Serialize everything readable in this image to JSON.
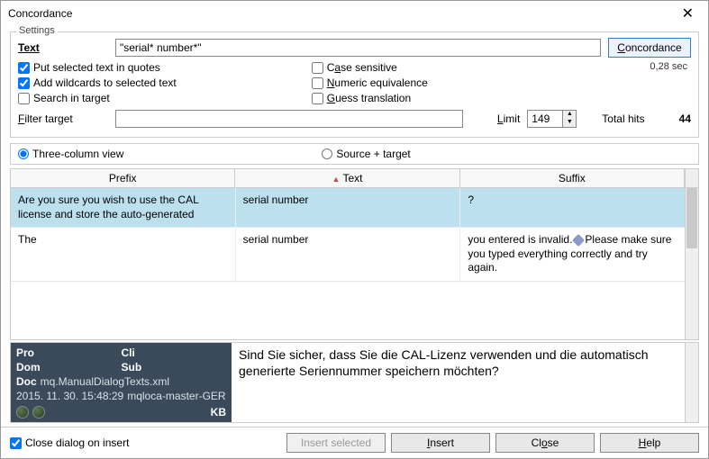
{
  "window": {
    "title": "Concordance"
  },
  "settings": {
    "legend": "Settings",
    "text_label": "Text",
    "text_value": "\"serial* number*\"",
    "concordance_btn": "Concordance",
    "timing": "0,28 sec",
    "put_quotes": "Put selected text in quotes",
    "add_wildcards": "Add wildcards to selected text",
    "search_target": "Search in target",
    "case_sensitive": "Case sensitive",
    "numeric_eq": "Numeric equivalence",
    "guess_trans": "Guess translation",
    "filter_label": "Filter target",
    "filter_value": "",
    "limit_label": "Limit",
    "limit_value": "149",
    "hits_label": "Total hits",
    "hits_value": "44"
  },
  "view": {
    "three_col": "Three-column view",
    "source_target": "Source + target"
  },
  "headers": {
    "prefix": "Prefix",
    "text": "Text",
    "suffix": "Suffix"
  },
  "rows": [
    {
      "prefix": "Are you sure you wish to use the CAL license and store the auto-generated",
      "text": "serial number",
      "suffix": "?"
    },
    {
      "prefix": "The",
      "text": "serial number",
      "suffix_a": " you entered is invalid.",
      "suffix_b": "Please make sure you typed everything correctly and try again."
    }
  ],
  "meta": {
    "pro": "Pro",
    "pro_v": "",
    "cli": "Cli",
    "cli_v": "",
    "dom": "Dom",
    "dom_v": "",
    "sub": "Sub",
    "sub_v": "",
    "doc_k": "Doc",
    "doc_v": "mq.ManualDialogTexts.xml",
    "ts": "2015. 11. 30. 15:48:29",
    "loc": "mqloca-master-GER",
    "kb": "KB"
  },
  "translation": "Sind Sie sicher, dass Sie die CAL-Lizenz verwenden und die automatisch generierte Seriennummer speichern möchten?",
  "footer": {
    "close_insert": "Close dialog on insert",
    "insert_selected": "Insert selected",
    "insert": "Insert",
    "close": "Close",
    "help": "Help"
  }
}
